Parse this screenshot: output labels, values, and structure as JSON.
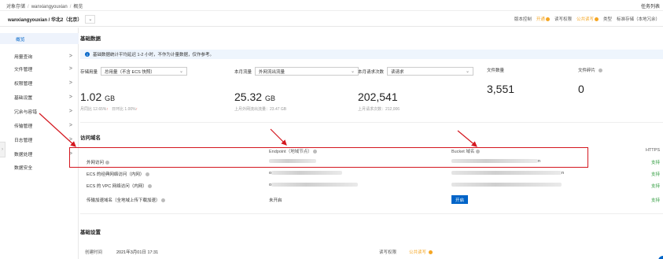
{
  "breadcrumb": [
    "对象存储",
    "wanxiangyouxian",
    "概览"
  ],
  "task_link": "任务列表",
  "bucket": {
    "name": "wanxiangyouxian / 华北2（北京）",
    "meta": {
      "version_label": "版本控制",
      "version_value": "开通",
      "acl_label": "读写权限",
      "acl_value": "公共读写",
      "type_label": "类型",
      "type_value": "标准存储（本地冗余）"
    }
  },
  "sidebar": {
    "items": [
      {
        "label": "概览",
        "arrow": ""
      },
      {
        "label": "用量查询",
        "arrow": ">"
      },
      {
        "label": "文件管理",
        "arrow": ">"
      },
      {
        "label": "权限管理",
        "arrow": ">"
      },
      {
        "label": "基础设置",
        "arrow": ">"
      },
      {
        "label": "冗余与容错",
        "arrow": ">"
      },
      {
        "label": "传输管理",
        "arrow": ">"
      },
      {
        "label": "日志管理",
        "arrow": ">"
      },
      {
        "label": "数据处理",
        "arrow": ">"
      },
      {
        "label": "数据安全",
        "arrow": ""
      }
    ]
  },
  "basic": {
    "title": "基础数据",
    "notice": "基础数据统计平均延迟 1-2 小时，不作为计量数据，仅作参考。",
    "stats": [
      {
        "label": "存储用量",
        "select": "总用量（不含 ECS 快照）",
        "value": "1.02",
        "unit": "GB",
        "sub1": "月同比 12.65%",
        "sub1_arrow": "↑",
        "sub2": "日环比 1.00%",
        "sub2_arrow": "↑"
      },
      {
        "label": "本月流量",
        "select": "外网流出流量",
        "value": "25.32",
        "unit": "GB",
        "sub1": "上月外网流出流量：23.47 GB"
      },
      {
        "label": "本月请求次数",
        "select": "读请求",
        "value": "202,541",
        "unit": "",
        "sub1": "上月请求次数：212,006"
      },
      {
        "label": "文件数量",
        "value": "3,551"
      },
      {
        "label": "文件碎片",
        "value": "0"
      }
    ]
  },
  "access": {
    "title": "访问域名",
    "col_endpoint": "Endpoint（地域节点）",
    "col_bucket": "Bucket 域名",
    "col_https": "HTTPS",
    "rows": [
      {
        "label": "外网访问",
        "endpoint": "",
        "bucket_domain": "n",
        "https": "支持"
      },
      {
        "label": "ECS 的经典网络访问（内网）",
        "endpoint": "o",
        "bucket_domain": "n",
        "https": "支持"
      },
      {
        "label": "ECS 的 VPC 网络访问（内网）",
        "endpoint": "o",
        "bucket_domain": "",
        "https": "支持"
      },
      {
        "label": "传输加速域名（全地域上传下载加速）",
        "endpoint": "未开启",
        "button": "开启",
        "https": "支持"
      }
    ]
  },
  "settings": {
    "title": "基础设置",
    "created_label": "创建时间",
    "created_value": "2021年3月01日 17:31",
    "acl_label": "读写权限",
    "acl_value": "公共读写"
  }
}
